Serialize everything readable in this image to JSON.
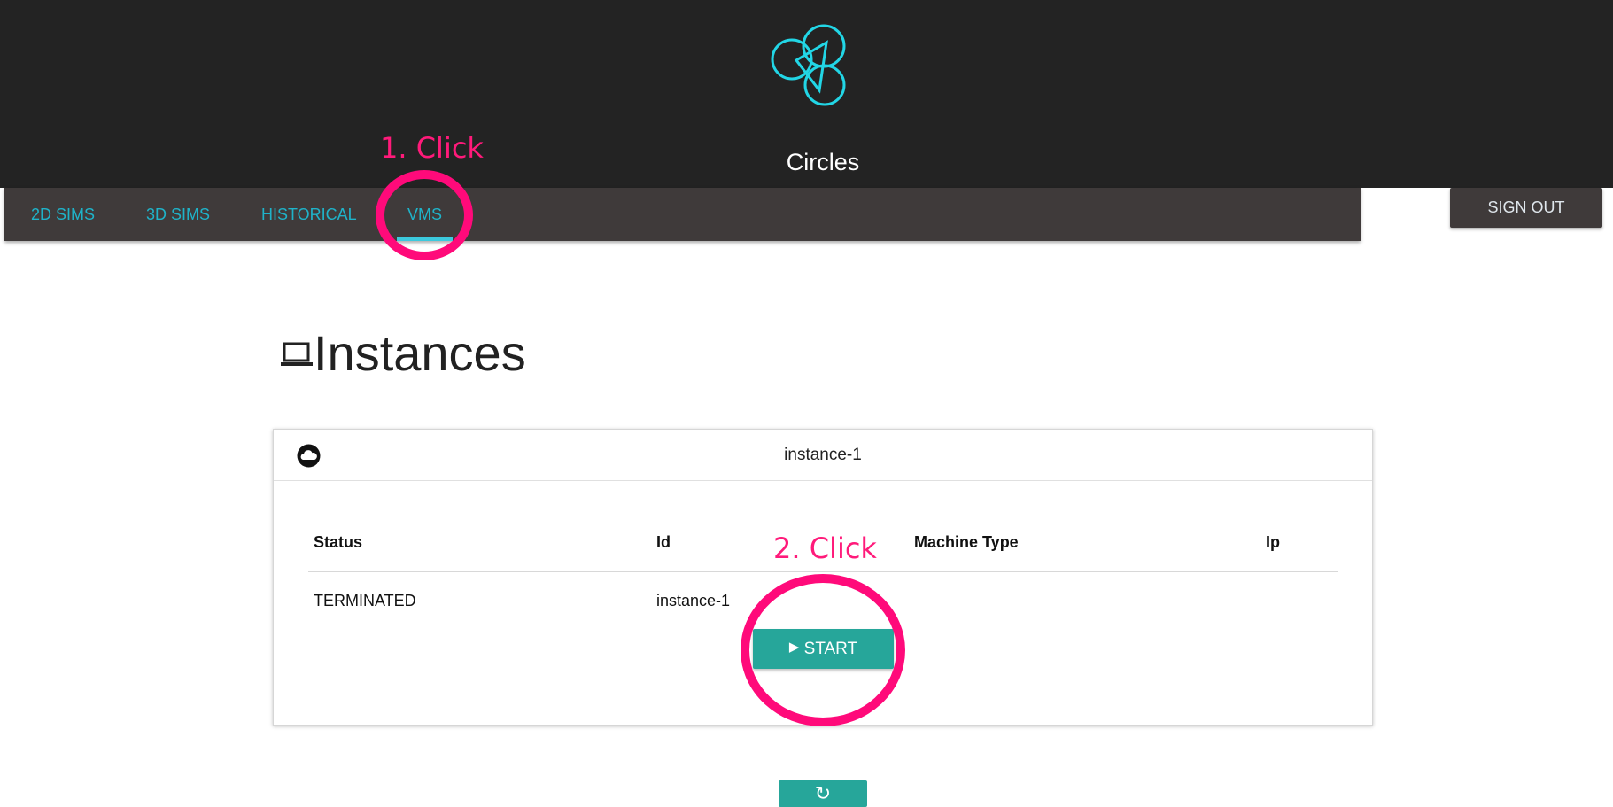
{
  "app": {
    "title": "Circles"
  },
  "nav": {
    "tabs": [
      {
        "label": "2D SIMS",
        "active": false
      },
      {
        "label": "3D SIMS",
        "active": false
      },
      {
        "label": "HISTORICAL",
        "active": false
      },
      {
        "label": "VMS",
        "active": true
      }
    ],
    "signout_label": "SIGN OUT"
  },
  "page": {
    "title": "Instances",
    "icon": "laptop-icon"
  },
  "instance_card": {
    "icon": "cloud-icon",
    "name": "instance-1",
    "table": {
      "headers": [
        "Status",
        "Id",
        "Machine Type",
        "Ip"
      ],
      "row": {
        "status": "TERMINATED",
        "id": "instance-1",
        "machine_type": "",
        "ip": ""
      }
    },
    "start_label": "START"
  },
  "refresh_icon": "refresh-icon",
  "annotations": {
    "step1": "1. Click",
    "step2": "2. Click"
  },
  "colors": {
    "header_bg": "#232323",
    "navbar_bg": "#3f3a3a",
    "tab_text": "#1fb3c9",
    "logo": "#22d6e6",
    "button_teal": "#26a69a",
    "annotation": "#ff0a7a"
  }
}
